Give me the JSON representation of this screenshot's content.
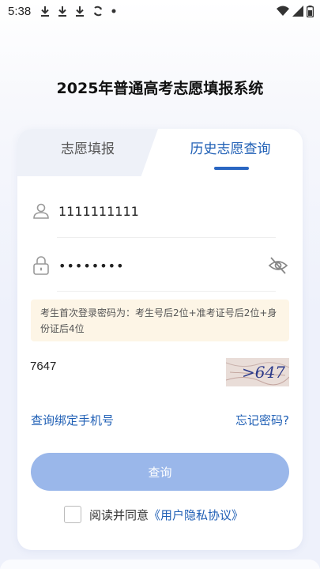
{
  "status_bar": {
    "time": "5:38",
    "icons_left": [
      "download-icon",
      "download-icon",
      "download-icon",
      "sync-icon",
      "dot-icon"
    ],
    "icons_right": [
      "wifi-icon",
      "signal-icon",
      "battery-icon"
    ]
  },
  "page": {
    "title": "2025年普通高考志愿填报系统"
  },
  "tabs": [
    {
      "label": "志愿填报",
      "active": false
    },
    {
      "label": "历史志愿查询",
      "active": true
    }
  ],
  "form": {
    "username": {
      "value": "1111111111",
      "icon": "user-icon"
    },
    "password": {
      "value": "••••••••",
      "icon": "lock-icon",
      "toggle_icon": "eye-off-icon"
    },
    "notice": "考生首次登录密码为：考生号后2位+准考证号后2位+身份证后4位",
    "captcha": {
      "value": "7647",
      "image_text": ">647"
    },
    "link_bind_phone": "查询绑定手机号",
    "link_forgot": "忘记密码?",
    "submit_label": "查询",
    "agree_prefix": "阅读并同意",
    "agree_link": "《用户隐私协议》"
  },
  "colors": {
    "accent": "#1f5fb5",
    "button": "#9ab7ea",
    "notice_bg": "#fdf5e6"
  }
}
